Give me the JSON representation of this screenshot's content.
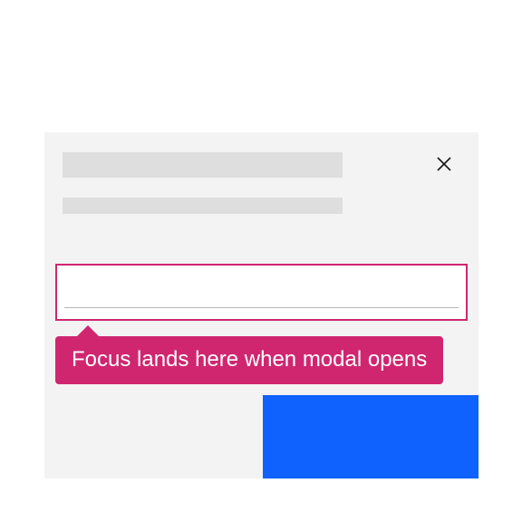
{
  "modal": {
    "close_aria": "Close",
    "tooltip_text": "Focus lands here when modal opens",
    "input_value": "",
    "primary_label": ""
  }
}
